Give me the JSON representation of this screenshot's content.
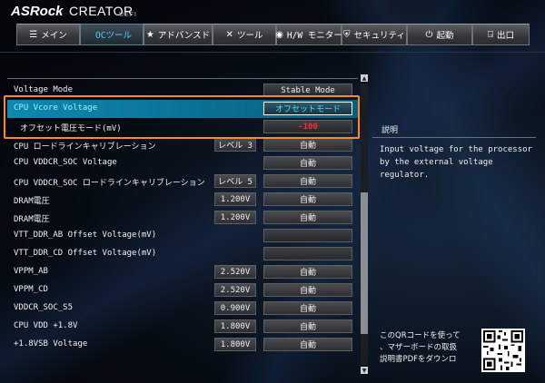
{
  "header": {
    "brand": "ASRock",
    "edition": "CREATOR",
    "uefi": "UEFI",
    "tabs": [
      {
        "icon": "☰",
        "label": "メイン"
      },
      {
        "icon": "",
        "label": "OCツール"
      },
      {
        "icon": "★",
        "label": "アドバンスド"
      },
      {
        "icon": "✕",
        "label": "ツール"
      },
      {
        "icon": "◉",
        "label": "H/W モニター"
      },
      {
        "icon": "⛨",
        "label": "セキュリティ"
      },
      {
        "icon": "⏻",
        "label": "起動"
      },
      {
        "icon": "⍈",
        "label": "出口"
      }
    ]
  },
  "settings": {
    "mode_row": {
      "label": "Voltage Mode",
      "option": "Stable Mode"
    },
    "rows": [
      {
        "label": "CPU Vcore Voltage",
        "value": "",
        "option": "オフセットモード"
      },
      {
        "label": "オフセット電圧モード(mV)",
        "value": "",
        "option": "-100"
      },
      {
        "label": "CPU ロードラインキャリブレーション",
        "value": "レベル 3",
        "option": "自動"
      },
      {
        "label": "CPU VDDCR_SOC Voltage",
        "value": "",
        "option": "自動"
      },
      {
        "label": "CPU VDDCR_SOC ロードラインキャリブレーション",
        "value": "レベル 5",
        "option": "自動"
      },
      {
        "label": "DRAM電圧",
        "value": "1.200V",
        "option": "自動"
      },
      {
        "label": "DRAM電圧",
        "value": "1.200V",
        "option": "自動"
      },
      {
        "label": "VTT_DDR_AB Offset Voltage(mV)",
        "value": "",
        "option": ""
      },
      {
        "label": "VTT_DDR_CD Offset Voltage(mV)",
        "value": "",
        "option": ""
      },
      {
        "label": "VPPM_AB",
        "value": "2.520V",
        "option": "自動"
      },
      {
        "label": "VPPM_CD",
        "value": "2.520V",
        "option": "自動"
      },
      {
        "label": "VDDCR_SOC_S5",
        "value": "0.900V",
        "option": "自動"
      },
      {
        "label": "CPU VDD +1.8V",
        "value": "1.800V",
        "option": "自動"
      },
      {
        "label": "+1.8VSB Voltage",
        "value": "1.800V",
        "option": "自動"
      }
    ]
  },
  "description": {
    "title": "説明",
    "text": "Input voltage for the processor by the external voltage regulator."
  },
  "qr": {
    "line1": "このQRコードを使って",
    "line2": "、マザーボードの取扱",
    "line3": "説明書PDFをダウンロ"
  },
  "colors": {
    "accent": "#4fd2ff",
    "selected_row": "#0e88b0",
    "highlight": "#ff8a1e",
    "negative_value": "#ff2d2d"
  }
}
